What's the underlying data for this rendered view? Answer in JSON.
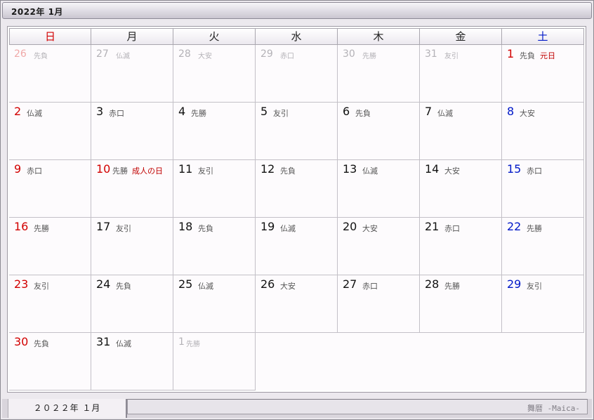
{
  "window": {
    "title": "2022年 1月"
  },
  "weekdays": [
    {
      "label": "日",
      "type": "sun"
    },
    {
      "label": "月",
      "type": "wd"
    },
    {
      "label": "火",
      "type": "wd"
    },
    {
      "label": "水",
      "type": "wd"
    },
    {
      "label": "木",
      "type": "wd"
    },
    {
      "label": "金",
      "type": "wd"
    },
    {
      "label": "土",
      "type": "sat"
    }
  ],
  "weeks": [
    [
      {
        "day": "26",
        "rokuyo": "先負",
        "other": true
      },
      {
        "day": "27",
        "rokuyo": "仏滅",
        "other": true
      },
      {
        "day": "28",
        "rokuyo": "大安",
        "other": true
      },
      {
        "day": "29",
        "rokuyo": "赤口",
        "other": true
      },
      {
        "day": "30",
        "rokuyo": "先勝",
        "other": true
      },
      {
        "day": "31",
        "rokuyo": "友引",
        "other": true
      },
      {
        "day": "1",
        "rokuyo": "先負",
        "holiday": "元日"
      }
    ],
    [
      {
        "day": "2",
        "rokuyo": "仏滅"
      },
      {
        "day": "3",
        "rokuyo": "赤口"
      },
      {
        "day": "4",
        "rokuyo": "先勝"
      },
      {
        "day": "5",
        "rokuyo": "友引"
      },
      {
        "day": "6",
        "rokuyo": "先負"
      },
      {
        "day": "7",
        "rokuyo": "仏滅"
      },
      {
        "day": "8",
        "rokuyo": "大安"
      }
    ],
    [
      {
        "day": "9",
        "rokuyo": "赤口"
      },
      {
        "day": "10",
        "rokuyo": "先勝",
        "holiday": "成人の日"
      },
      {
        "day": "11",
        "rokuyo": "友引"
      },
      {
        "day": "12",
        "rokuyo": "先負"
      },
      {
        "day": "13",
        "rokuyo": "仏滅"
      },
      {
        "day": "14",
        "rokuyo": "大安"
      },
      {
        "day": "15",
        "rokuyo": "赤口"
      }
    ],
    [
      {
        "day": "16",
        "rokuyo": "先勝"
      },
      {
        "day": "17",
        "rokuyo": "友引"
      },
      {
        "day": "18",
        "rokuyo": "先負"
      },
      {
        "day": "19",
        "rokuyo": "仏滅"
      },
      {
        "day": "20",
        "rokuyo": "大安"
      },
      {
        "day": "21",
        "rokuyo": "赤口"
      },
      {
        "day": "22",
        "rokuyo": "先勝"
      }
    ],
    [
      {
        "day": "23",
        "rokuyo": "友引"
      },
      {
        "day": "24",
        "rokuyo": "先負"
      },
      {
        "day": "25",
        "rokuyo": "仏滅"
      },
      {
        "day": "26",
        "rokuyo": "大安"
      },
      {
        "day": "27",
        "rokuyo": "赤口"
      },
      {
        "day": "28",
        "rokuyo": "先勝"
      },
      {
        "day": "29",
        "rokuyo": "友引"
      }
    ],
    [
      {
        "day": "30",
        "rokuyo": "先負"
      },
      {
        "day": "31",
        "rokuyo": "仏滅"
      },
      {
        "day": "1",
        "rokuyo": "先勝",
        "other": true
      },
      null,
      null,
      null,
      null
    ]
  ],
  "statusbar": {
    "tab_label": "２０２２年 １月",
    "app_name": "舞暦 -Maica-"
  },
  "colors": {
    "sunday": "#d20000",
    "saturday": "#0018c8",
    "holiday_text": "#c00000",
    "other_month": "#b4b2b7"
  }
}
